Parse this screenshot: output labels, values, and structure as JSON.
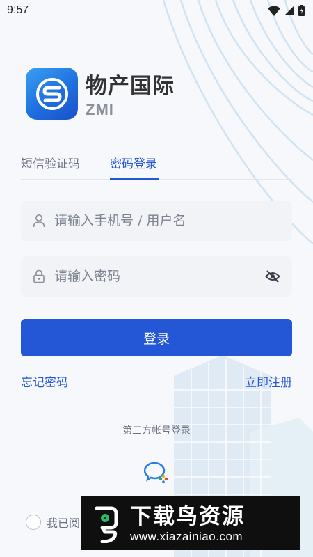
{
  "status_bar": {
    "time": "9:57"
  },
  "app": {
    "name": "物产国际",
    "subtitle": "ZMI"
  },
  "tabs": [
    {
      "label": "短信验证码",
      "active": false
    },
    {
      "label": "密码登录",
      "active": true
    }
  ],
  "form": {
    "username_placeholder": "请输入手机号 / 用户名",
    "password_placeholder": "请输入密码",
    "login_label": "登录"
  },
  "links": {
    "forgot": "忘记密码",
    "register": "立即注册"
  },
  "third_party": {
    "label": "第三方帐号登录",
    "provider_icon": "wechat-work-icon"
  },
  "agreement": {
    "text": "我已阅"
  },
  "watermark": {
    "title": "下载鸟资源",
    "url": "www.xiazainiao.com"
  },
  "colors": {
    "primary": "#2457d6",
    "background": "#f6f8fb",
    "field_bg": "#f1f3f7"
  }
}
